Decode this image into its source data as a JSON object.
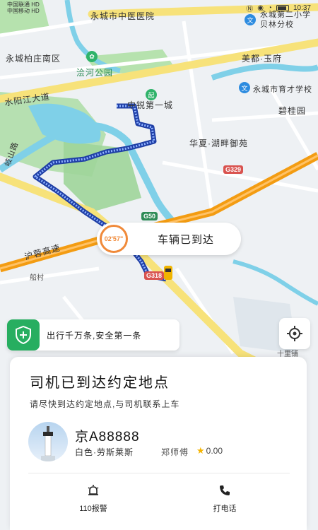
{
  "status_bar": {
    "carrier_line1": "中国联通 HD",
    "carrier_line2": "中国移动 HD",
    "time": "10:37"
  },
  "map": {
    "labels": [
      {
        "id": "label-yongcheng-hospital",
        "text": "永城市中医医院"
      },
      {
        "id": "label-yongcheng-second",
        "text": "永城第二小学贝林分校"
      },
      {
        "id": "label-baitingnanqu",
        "text": "永城柏庄南区"
      },
      {
        "id": "label-huohe-park",
        "text": "浍河公园"
      },
      {
        "id": "label-meidu-yufu",
        "text": "美都·玉府"
      },
      {
        "id": "label-yucai-school",
        "text": "永城市育才学校"
      },
      {
        "id": "label-shuiyang-dadao",
        "text": "水阳江大道"
      },
      {
        "id": "label-zhongjian-yicheng",
        "text": "中锐第一城"
      },
      {
        "id": "label-biguiyuan",
        "text": "碧桂园"
      },
      {
        "id": "label-huaxia-hupan",
        "text": "华夏·湖畔御苑"
      },
      {
        "id": "label-qishan-road",
        "text": "岐山路"
      },
      {
        "id": "label-hubin-gaosu",
        "text": "沪蓉高速"
      },
      {
        "id": "label-chuancun",
        "text": "船村"
      },
      {
        "id": "label-shilipu",
        "text": "十里铺"
      }
    ],
    "road_tags": [
      {
        "id": "tag-g329",
        "text": "G329"
      },
      {
        "id": "tag-g50",
        "text": "G50"
      },
      {
        "id": "tag-g318",
        "text": "G318"
      }
    ],
    "start_marker": "起"
  },
  "arrive": {
    "timer": "02'57\"",
    "text": "车辆已到达"
  },
  "safety": {
    "text": "出行千万条,安全第一条"
  },
  "card": {
    "title": "司机已到达约定地点",
    "subtitle": "请尽快到达约定地点,与司机联系上车",
    "plate": "京A88888",
    "car_model": "白色·劳斯莱斯",
    "driver": "郑师傅",
    "rating": "0.00",
    "actions": {
      "police_label": "110报警",
      "call_label": "打电话"
    }
  },
  "colors": {
    "accent_orange": "#f08a3a",
    "safety_green": "#27ae60",
    "route_blue": "#3f6fd6",
    "highway_orange": "#f39c12",
    "road_yellow": "#f7e27a",
    "water": "#7fd0e8",
    "park_green": "#a8dca0"
  }
}
